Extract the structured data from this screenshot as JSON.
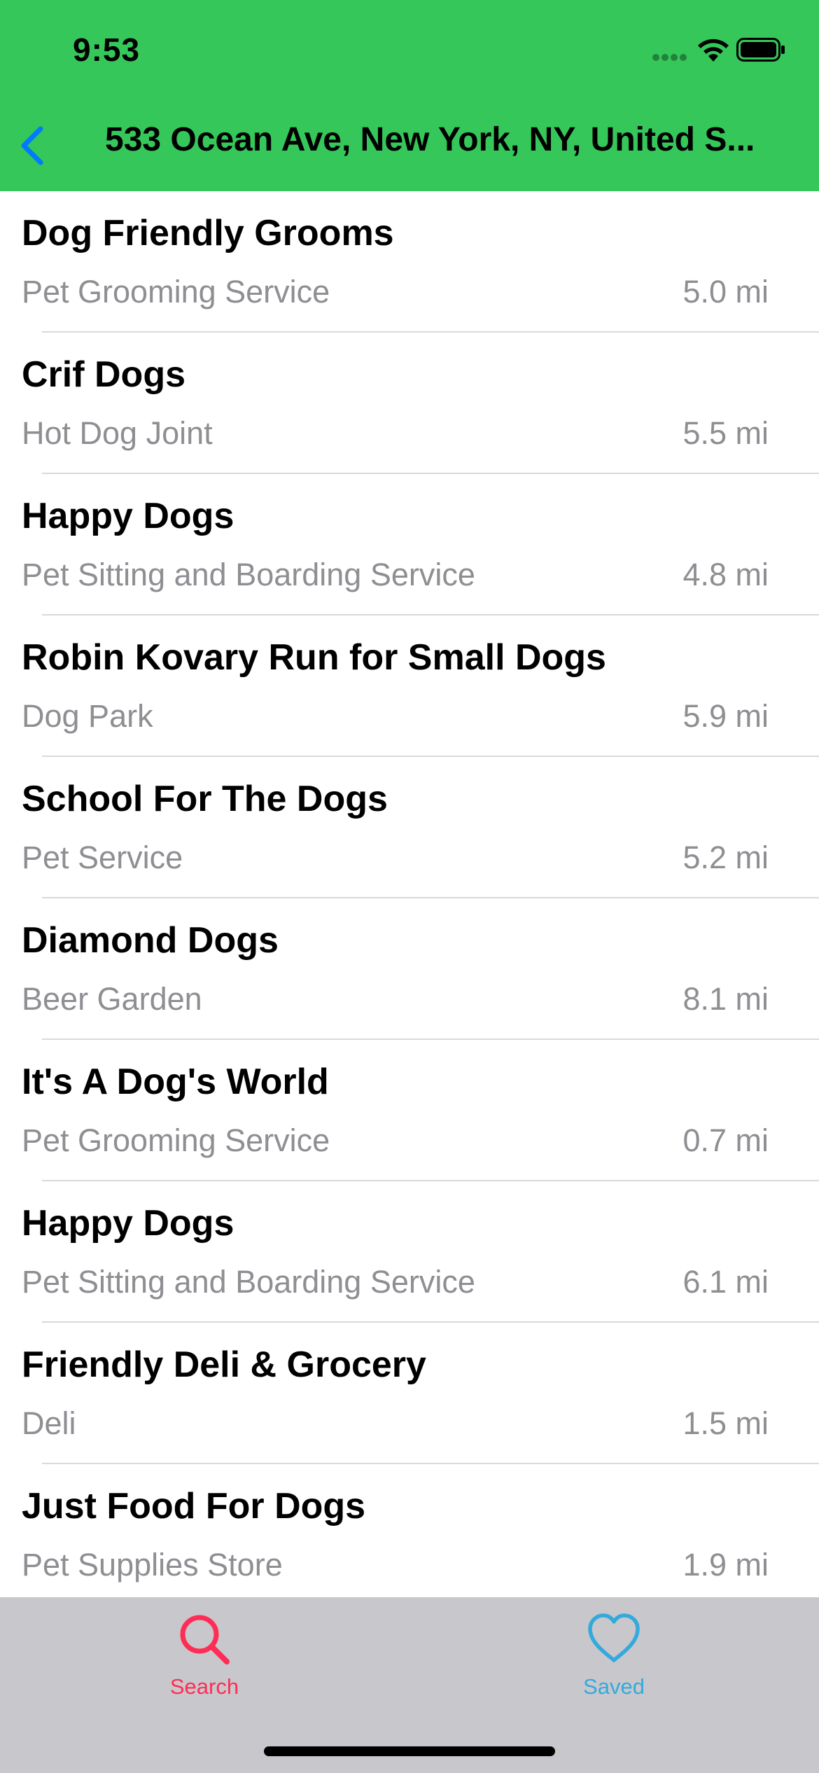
{
  "status_bar": {
    "time": "9:53",
    "signal_icon": "cellular-signal-icon",
    "wifi_icon": "wifi-icon",
    "battery_icon": "battery-icon"
  },
  "nav": {
    "back_icon": "chevron-left-icon",
    "title": "533 Ocean Ave, New York, NY, United S..."
  },
  "results": [
    {
      "name": "Dog Friendly Grooms",
      "category": "Pet Grooming Service",
      "distance": "5.0 mi"
    },
    {
      "name": "Crif Dogs",
      "category": "Hot Dog Joint",
      "distance": "5.5 mi"
    },
    {
      "name": "Happy Dogs",
      "category": "Pet Sitting and Boarding Service",
      "distance": "4.8 mi"
    },
    {
      "name": "Robin Kovary Run for Small Dogs",
      "category": "Dog Park",
      "distance": "5.9 mi"
    },
    {
      "name": "School For The Dogs",
      "category": "Pet Service",
      "distance": "5.2 mi"
    },
    {
      "name": "Diamond Dogs",
      "category": "Beer Garden",
      "distance": "8.1 mi"
    },
    {
      "name": "It's A Dog's World",
      "category": "Pet Grooming Service",
      "distance": "0.7 mi"
    },
    {
      "name": "Happy Dogs",
      "category": "Pet Sitting and Boarding Service",
      "distance": "6.1 mi"
    },
    {
      "name": "Friendly Deli & Grocery",
      "category": "Deli",
      "distance": "1.5 mi"
    },
    {
      "name": "Just Food For Dogs",
      "category": "Pet Supplies Store",
      "distance": "1.9 mi"
    }
  ],
  "tabbar": {
    "search": {
      "label": "Search",
      "icon": "search-icon",
      "color": "#ff2d55",
      "selected": true
    },
    "saved": {
      "label": "Saved",
      "icon": "heart-icon",
      "color": "#34aadc",
      "selected": false
    }
  },
  "colors": {
    "header_green": "#35c759",
    "back_blue": "#007aff",
    "secondary_text": "#8e8e93",
    "tabbar_bg": "#c8c7cc"
  }
}
